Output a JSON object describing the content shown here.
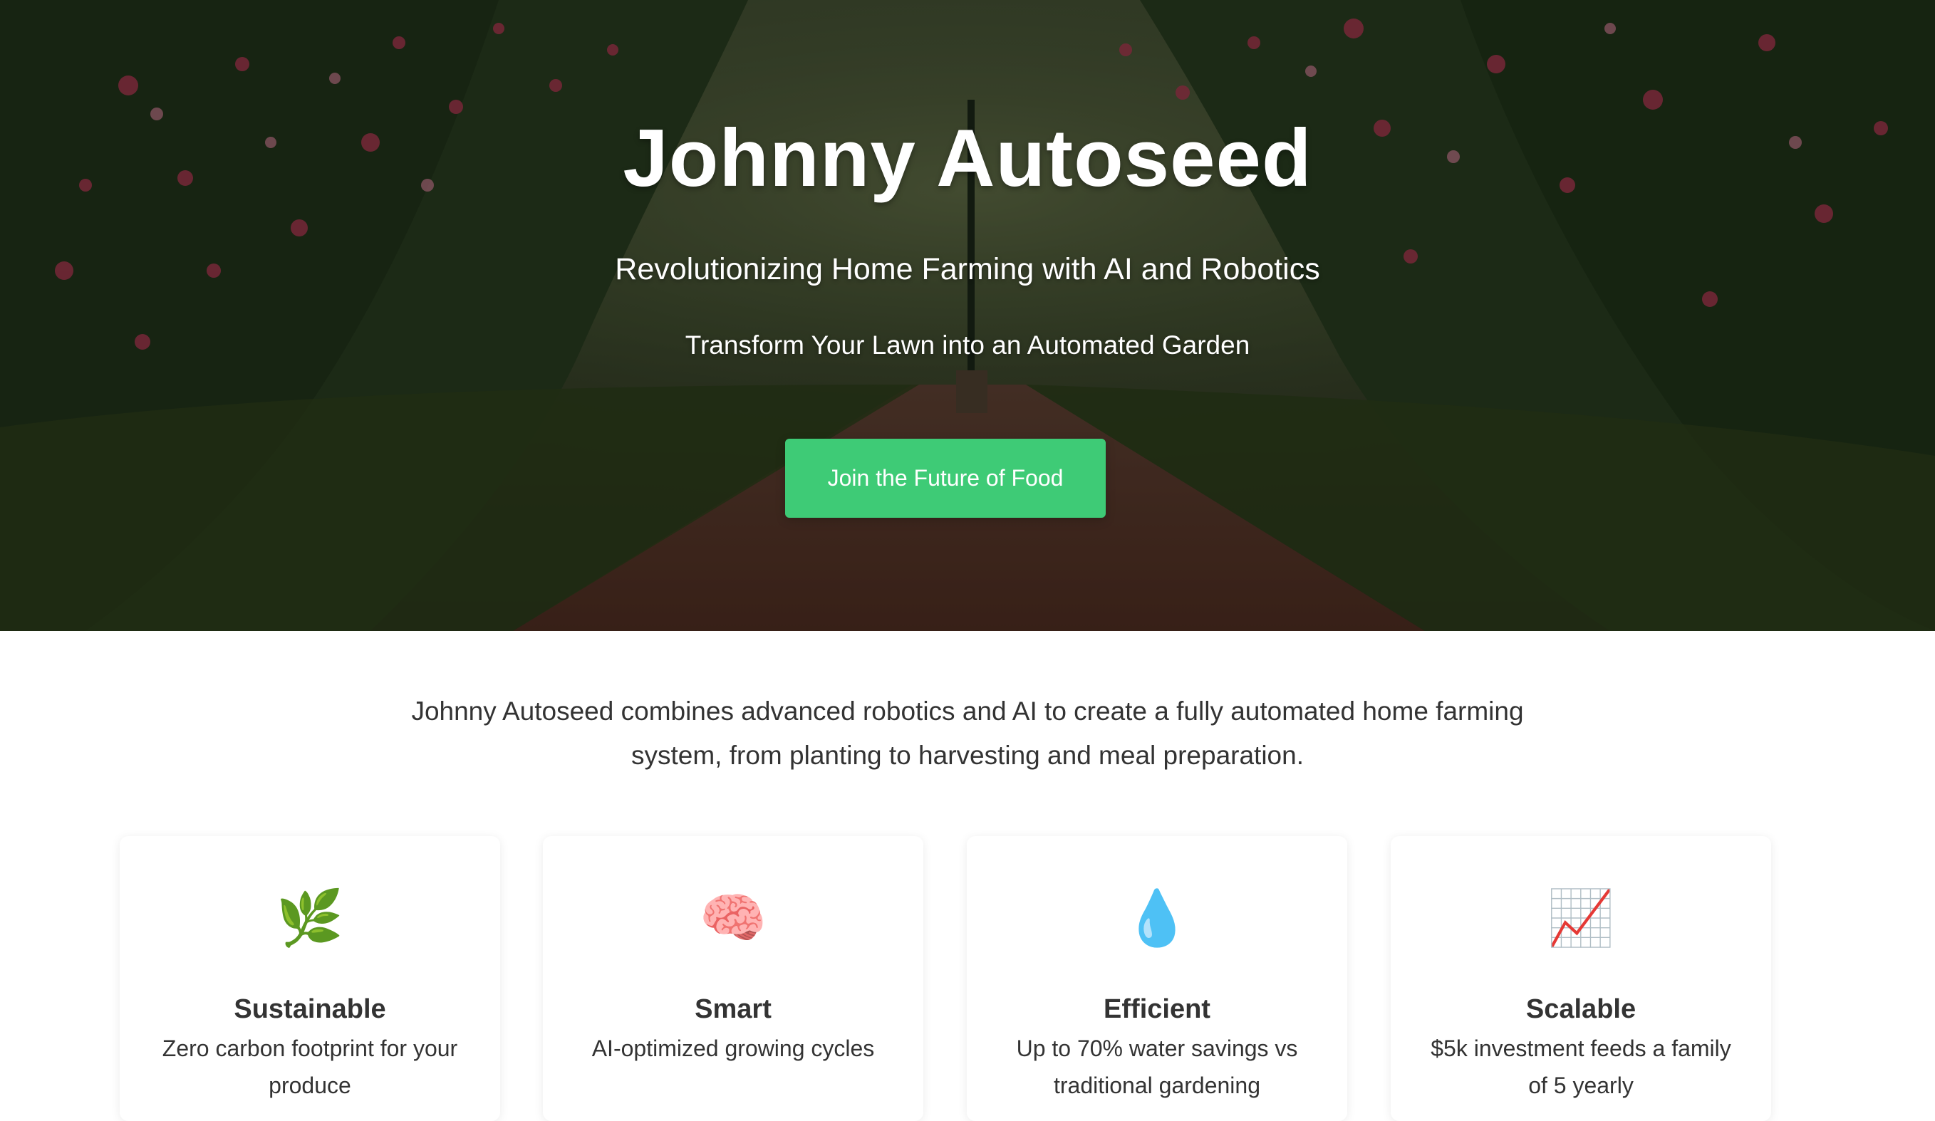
{
  "hero": {
    "title": "Johnny Autoseed",
    "subtitle": "Revolutionizing Home Farming with AI and Robotics",
    "tagline": "Transform Your Lawn into an Automated Garden",
    "cta_label": "Join the Future of Food",
    "cta_color": "#3ecb76"
  },
  "intro": {
    "text": "Johnny Autoseed combines advanced robotics and AI to create a fully automated home farming system, from planting to harvesting and meal preparation."
  },
  "features": [
    {
      "icon_name": "herb-icon",
      "icon": "🌿",
      "title": "Sustainable",
      "description": "Zero carbon footprint for your produce"
    },
    {
      "icon_name": "brain-icon",
      "icon": "🧠",
      "title": "Smart",
      "description": "AI-optimized growing cycles"
    },
    {
      "icon_name": "droplet-icon",
      "icon": "💧",
      "title": "Efficient",
      "description": "Up to 70% water savings vs traditional gardening"
    },
    {
      "icon_name": "chart-increasing-icon",
      "icon": "📈",
      "title": "Scalable",
      "description": "$5k investment feeds a family of 5 yearly"
    }
  ]
}
